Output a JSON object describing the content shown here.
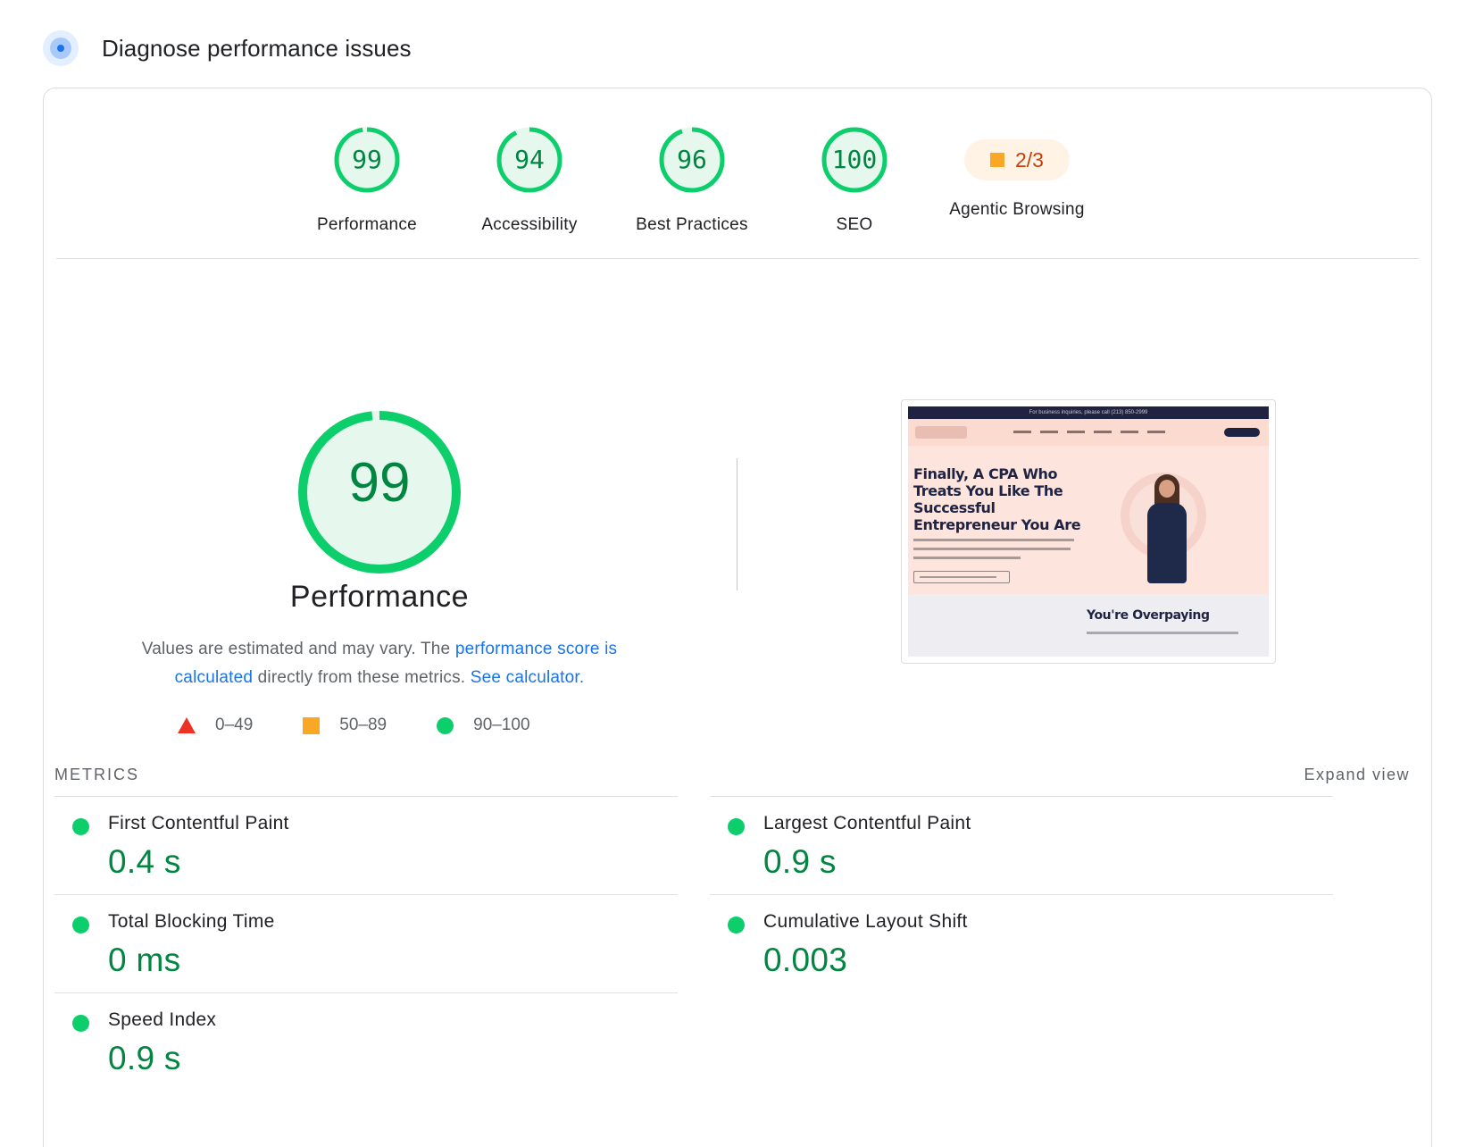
{
  "header": {
    "title": "Diagnose performance issues",
    "icon": "radar-icon"
  },
  "colors": {
    "pass": "#0cce6b",
    "pass_text": "#018642",
    "average": "#f9a825",
    "fail": "#eb3223",
    "link": "#1a73e8"
  },
  "scores": [
    {
      "label": "Performance",
      "value": "99",
      "score": 99
    },
    {
      "label": "Accessibility",
      "value": "94",
      "score": 94
    },
    {
      "label": "Best Practices",
      "value": "96",
      "score": 96
    },
    {
      "label": "SEO",
      "value": "100",
      "score": 100
    }
  ],
  "agentic": {
    "label": "Agentic Browsing",
    "value": "2/3"
  },
  "performance": {
    "score": "99",
    "score_value": 99,
    "title": "Performance",
    "desc_prefix": "Values are estimated and may vary. The ",
    "desc_link1": "performance score is calculated",
    "desc_middle": " directly from these metrics. ",
    "desc_link2": "See calculator.",
    "legend": [
      {
        "shape": "triangle",
        "range": "0–49"
      },
      {
        "shape": "square",
        "range": "50–89"
      },
      {
        "shape": "circle",
        "range": "90–100"
      }
    ]
  },
  "thumbnail": {
    "topbar": "For business inquiries, please call (213) 850-2999",
    "heading": "Finally, A CPA Who Treats You Like The Successful Entrepreneur You Are",
    "subheading": "You're Overpaying"
  },
  "metrics": {
    "label": "METRICS",
    "expand": "Expand view",
    "items": [
      {
        "name": "First Contentful Paint",
        "value": "0.4 s"
      },
      {
        "name": "Largest Contentful Paint",
        "value": "0.9 s"
      },
      {
        "name": "Total Blocking Time",
        "value": "0 ms"
      },
      {
        "name": "Cumulative Layout Shift",
        "value": "0.003"
      },
      {
        "name": "Speed Index",
        "value": "0.9 s"
      }
    ]
  }
}
